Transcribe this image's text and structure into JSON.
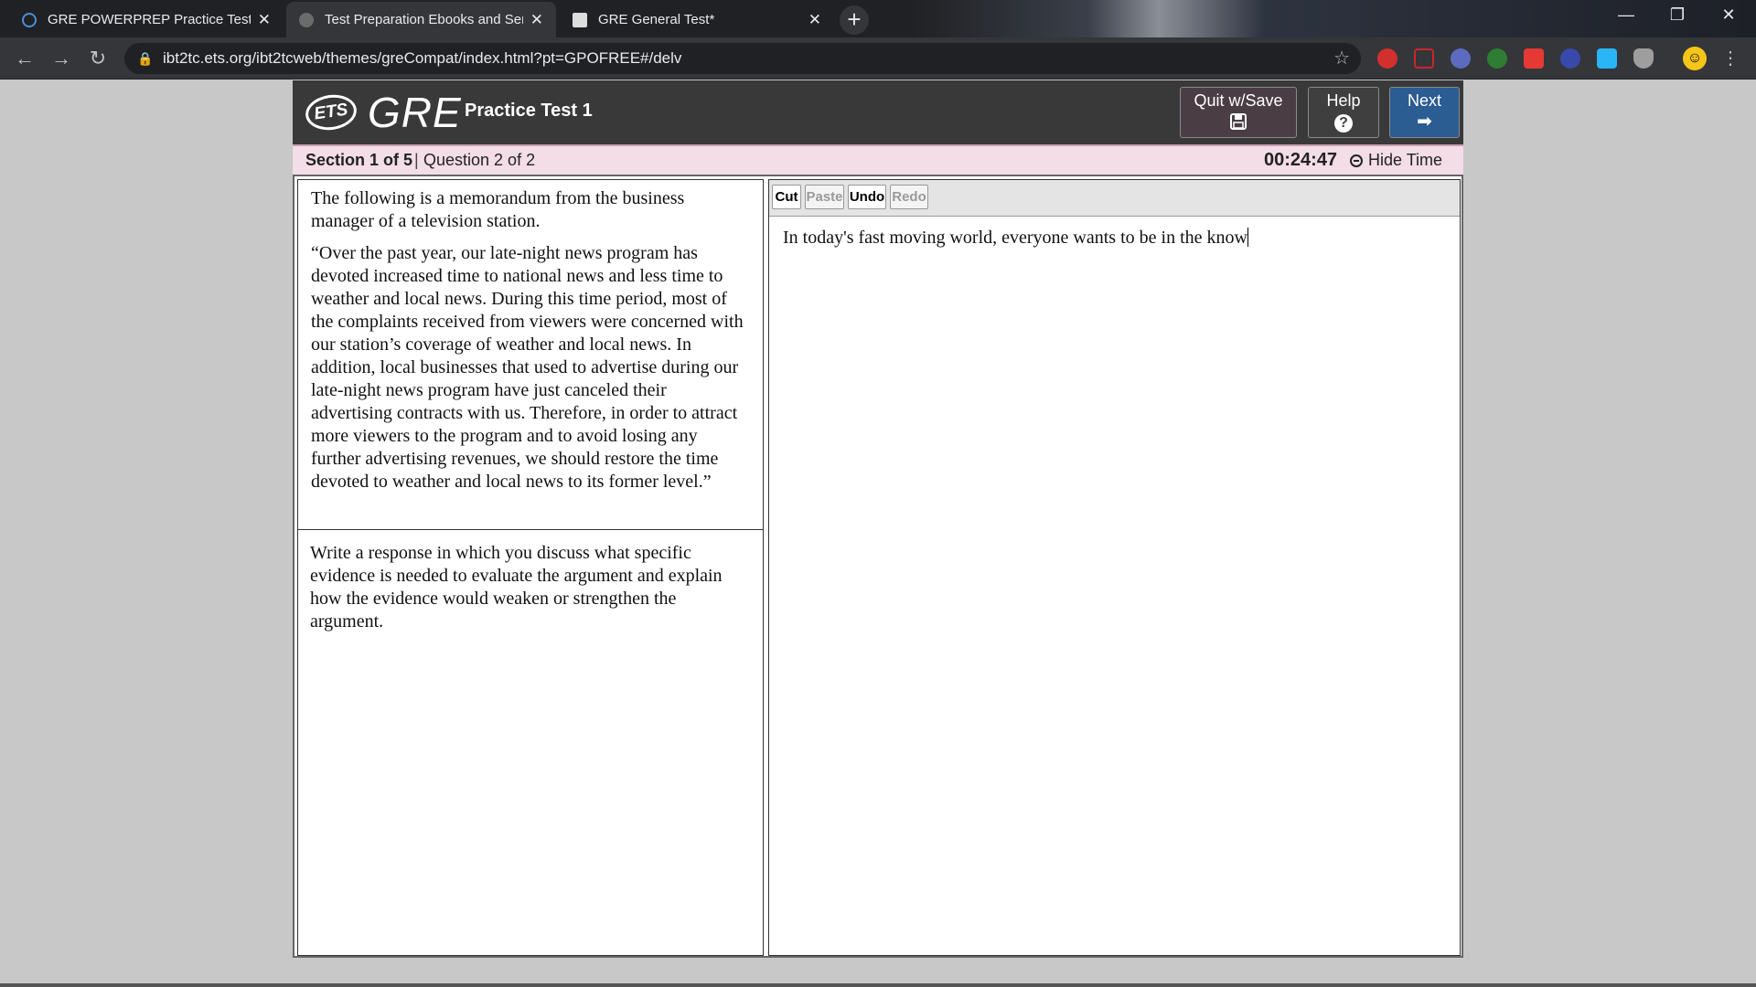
{
  "browser": {
    "tabs": [
      {
        "title": "GRE POWERPREP Practice Tests",
        "active": false
      },
      {
        "title": "Test Preparation Ebooks and Ser",
        "active": true
      },
      {
        "title": "GRE General Test*",
        "active": false
      }
    ],
    "url": "ibt2tc.ets.org/ibt2tcweb/themes/greCompat/index.html?pt=GPOFREE#/delv"
  },
  "header": {
    "ets_logo": "ETS",
    "gre_logo": "GRE",
    "test_title": "Practice Test 1",
    "buttons": {
      "quit": "Quit w/Save",
      "help": "Help",
      "next": "Next"
    }
  },
  "status": {
    "section": "Section 1 of 5",
    "separator": "|",
    "question": "Question 2 of 2",
    "timer": "00:24:47",
    "hide_time": "Hide Time"
  },
  "passage": {
    "intro": "The following is a memorandum from the business manager of a television station.",
    "body": "“Over the past year, our late-night news program has devoted increased time to national news and less time to weather and local news. During this time period, most of the complaints received from viewers were concerned with our station’s coverage of weather and local news. In addition, local businesses that used to advertise during our late-night news program have just canceled their advertising contracts with us. Therefore, in order to attract more viewers to the program and to avoid losing any further advertising revenues, we should restore the time devoted to weather and local news to its former level.”",
    "prompt": "Write a response in which you discuss what specific evidence is needed to evaluate the argument and explain how the evidence would weaken or strengthen the argument."
  },
  "editor": {
    "buttons": {
      "cut": "Cut",
      "paste": "Paste",
      "undo": "Undo",
      "redo": "Redo"
    },
    "text": "In today's fast moving world, everyone wants to be in the know"
  },
  "colors": {
    "header_bg": "#393939",
    "section_bar_bg": "#f3dde6",
    "next_button": "#2b5c92",
    "quit_button": "#4a3d44"
  }
}
